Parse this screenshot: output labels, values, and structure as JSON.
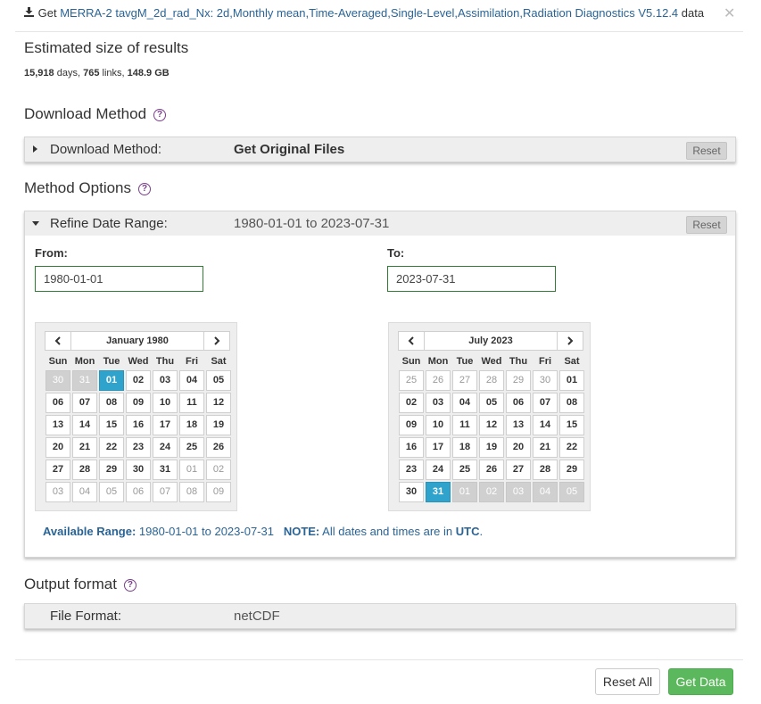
{
  "header": {
    "prefix": "Get",
    "dataset_link": "MERRA-2 tavgM_2d_rad_Nx: 2d,Monthly mean,Time-Averaged,Single-Level,Assimilation,Radiation Diagnostics V5.12.4",
    "suffix": "data",
    "close_glyph": "✕"
  },
  "estimate": {
    "title": "Estimated size of results",
    "days": "15,918",
    "days_unit": "days,",
    "links": "765",
    "links_unit": "links,",
    "size": "148.9 GB"
  },
  "download_method": {
    "section_title": "Download Method",
    "label": "Download Method:",
    "value": "Get Original Files",
    "reset_label": "Reset"
  },
  "method_options": {
    "section_title": "Method Options",
    "label": "Refine Date Range:",
    "value": "1980-01-01 to 2023-07-31",
    "reset_label": "Reset",
    "from_label": "From:",
    "from_value": "1980-01-01",
    "to_label": "To:",
    "to_value": "2023-07-31"
  },
  "weekdays": [
    "Sun",
    "Mon",
    "Tue",
    "Wed",
    "Thu",
    "Fri",
    "Sat"
  ],
  "calendars": [
    {
      "month": "January 1980",
      "days": [
        [
          "30",
          "31",
          "01",
          "02",
          "03",
          "04",
          "05"
        ],
        [
          "06",
          "07",
          "08",
          "09",
          "10",
          "11",
          "12"
        ],
        [
          "13",
          "14",
          "15",
          "16",
          "17",
          "18",
          "19"
        ],
        [
          "20",
          "21",
          "22",
          "23",
          "24",
          "25",
          "26"
        ],
        [
          "27",
          "28",
          "29",
          "30",
          "31",
          "01",
          "02"
        ],
        [
          "03",
          "04",
          "05",
          "06",
          "07",
          "08",
          "09"
        ]
      ],
      "states": [
        [
          "d",
          "d",
          "s",
          "c",
          "c",
          "c",
          "c"
        ],
        [
          "c",
          "c",
          "c",
          "c",
          "c",
          "c",
          "c"
        ],
        [
          "c",
          "c",
          "c",
          "c",
          "c",
          "c",
          "c"
        ],
        [
          "c",
          "c",
          "c",
          "c",
          "c",
          "c",
          "c"
        ],
        [
          "c",
          "c",
          "c",
          "c",
          "c",
          "o",
          "o"
        ],
        [
          "o",
          "o",
          "o",
          "o",
          "o",
          "o",
          "o"
        ]
      ]
    },
    {
      "month": "July 2023",
      "days": [
        [
          "25",
          "26",
          "27",
          "28",
          "29",
          "30",
          "01"
        ],
        [
          "02",
          "03",
          "04",
          "05",
          "06",
          "07",
          "08"
        ],
        [
          "09",
          "10",
          "11",
          "12",
          "13",
          "14",
          "15"
        ],
        [
          "16",
          "17",
          "18",
          "19",
          "20",
          "21",
          "22"
        ],
        [
          "23",
          "24",
          "25",
          "26",
          "27",
          "28",
          "29"
        ],
        [
          "30",
          "31",
          "01",
          "02",
          "03",
          "04",
          "05"
        ]
      ],
      "states": [
        [
          "o",
          "o",
          "o",
          "o",
          "o",
          "o",
          "c"
        ],
        [
          "c",
          "c",
          "c",
          "c",
          "c",
          "c",
          "c"
        ],
        [
          "c",
          "c",
          "c",
          "c",
          "c",
          "c",
          "c"
        ],
        [
          "c",
          "c",
          "c",
          "c",
          "c",
          "c",
          "c"
        ],
        [
          "c",
          "c",
          "c",
          "c",
          "c",
          "c",
          "c"
        ],
        [
          "c",
          "s",
          "d",
          "d",
          "d",
          "d",
          "d"
        ]
      ]
    }
  ],
  "available_range": {
    "label": "Available Range:",
    "value": "1980-01-01 to 2023-07-31",
    "note_label": "NOTE:",
    "note_text": "All dates and times are in",
    "utc": "UTC",
    "period": "."
  },
  "output_format": {
    "section_title": "Output format",
    "label": "File Format:",
    "value": "netCDF"
  },
  "footer": {
    "reset_all_label": "Reset All",
    "get_data_label": "Get Data"
  },
  "colors": {
    "link": "#2a6496",
    "selected_day": "#2fa3cc",
    "get_data_button": "#5cb85c",
    "help_icon": "#7a3e8c"
  },
  "icons": [
    "download-icon",
    "close-icon",
    "help-icon",
    "caret-right-icon",
    "caret-down-icon",
    "chevron-left-icon",
    "chevron-right-icon"
  ]
}
